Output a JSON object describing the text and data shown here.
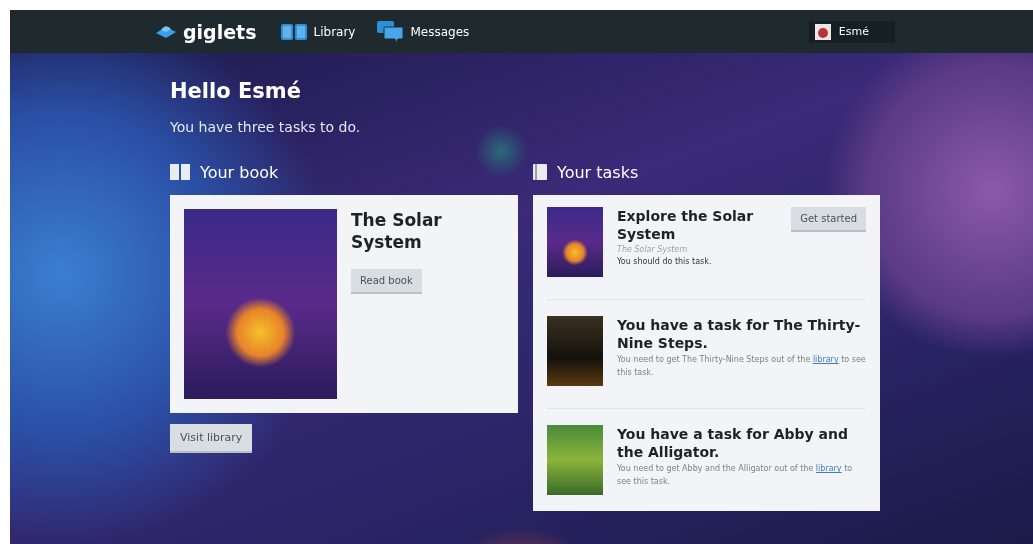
{
  "nav": {
    "brand": "giglets",
    "items": [
      {
        "label": "Library"
      },
      {
        "label": "Messages"
      }
    ],
    "user": "Esmé"
  },
  "greeting": "Hello Esmé",
  "summary": "You have three tasks to do.",
  "book_section": {
    "heading": "Your book",
    "title": "The Solar System",
    "button": "Read book",
    "footer_button": "Visit library"
  },
  "tasks_section": {
    "heading": "Your tasks",
    "tasks": [
      {
        "kind": "available",
        "title": "Explore the Solar System",
        "book": "The Solar System",
        "note": "You should do this task.",
        "button": "Get started"
      },
      {
        "kind": "locked",
        "title": "You have a task for The Thirty-Nine Steps.",
        "message_before": "You need to get The Thirty-Nine Steps out of the",
        "link": "library",
        "message_after": "to see this task."
      },
      {
        "kind": "locked",
        "title": "You have a task for Abby and the Alligator.",
        "message_before": "You need to get Abby and the Alligator out of the",
        "link": "library",
        "message_after": "to see this task."
      }
    ]
  }
}
